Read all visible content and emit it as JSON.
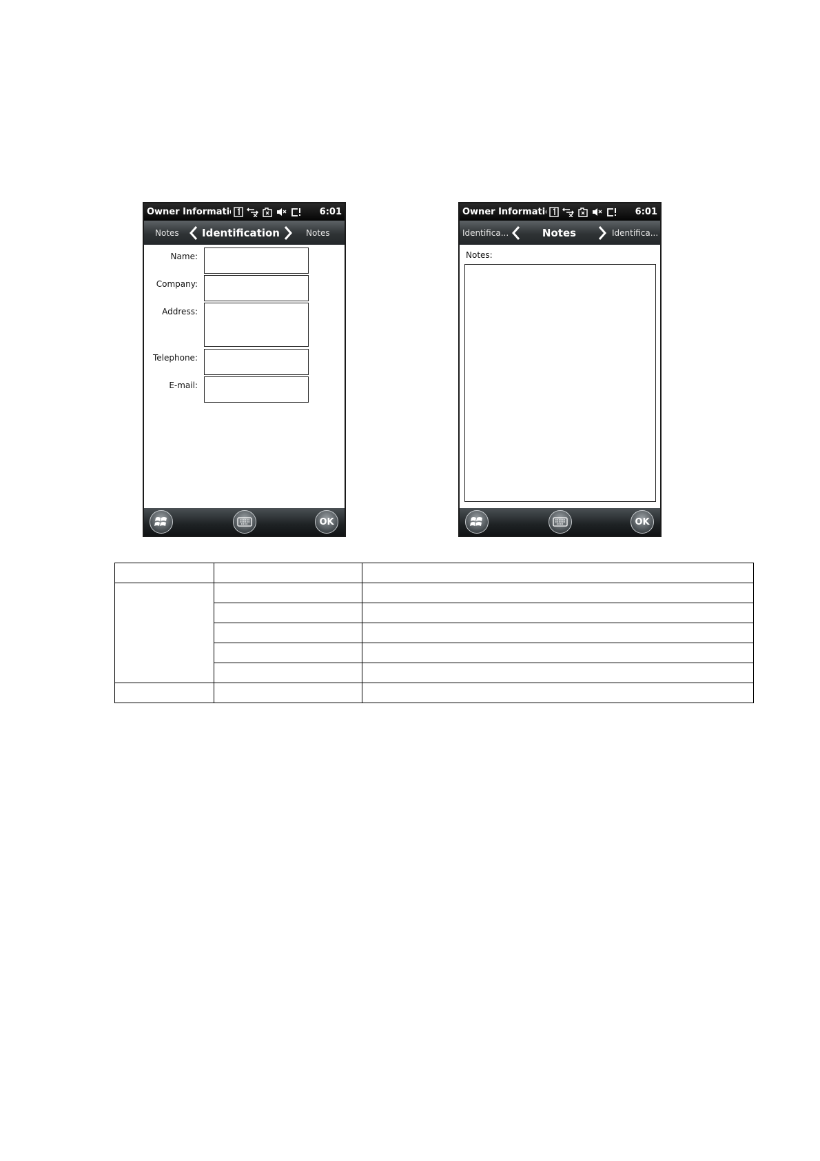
{
  "screens": {
    "identification": {
      "status_title": "Owner Informatior",
      "clock": "6:01",
      "nav": {
        "prev": "Notes",
        "title": "Identification",
        "next": "Notes"
      },
      "fields": [
        {
          "label": "Name:",
          "value": ""
        },
        {
          "label": "Company:",
          "value": ""
        },
        {
          "label": "Address:",
          "value": ""
        },
        {
          "label": "Telephone:",
          "value": ""
        },
        {
          "label": "E-mail:",
          "value": ""
        }
      ],
      "softkeys": {
        "start": "start-icon",
        "keyboard": "keyboard-icon",
        "ok": "OK"
      }
    },
    "notes": {
      "status_title": "Owner Information",
      "clock": "6:01",
      "nav": {
        "prev": "Identifica...",
        "title": "Notes",
        "next": "Identifica..."
      },
      "notes_label": "Notes:",
      "notes_value": "",
      "softkeys": {
        "start": "start-icon",
        "keyboard": "keyboard-icon",
        "ok": "OK"
      }
    }
  },
  "status_icons": [
    "sim-1-icon",
    "connectivity-off-icon",
    "battery-icon",
    "speaker-muted-icon",
    "signal-icon"
  ],
  "colors": {
    "bar_dark": "#050505",
    "nav_mid": "#2f3335",
    "text_light": "#ffffff"
  }
}
